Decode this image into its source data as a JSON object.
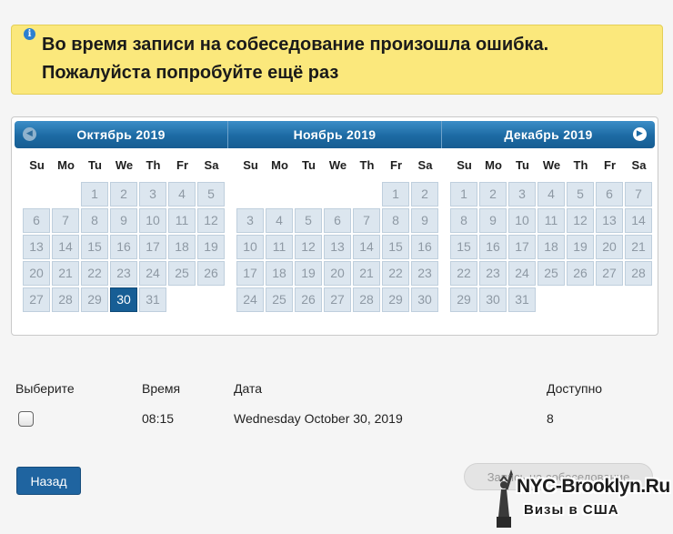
{
  "alert": {
    "icon": "info-icon",
    "line1": "Во время записи на собеседование произошла ошибка.",
    "line2": "Пожалуйста попробуйте ещё раз"
  },
  "calendar": {
    "weekdays": [
      "Su",
      "Mo",
      "Tu",
      "We",
      "Th",
      "Fr",
      "Sa"
    ],
    "prev_icon": "chevron-left-icon",
    "next_icon": "chevron-right-icon",
    "selected_date": "30",
    "months": [
      {
        "title": "Октябрь 2019",
        "cells": [
          "",
          "",
          "1",
          "2",
          "3",
          "4",
          "5",
          "6",
          "7",
          "8",
          "9",
          "10",
          "11",
          "12",
          "13",
          "14",
          "15",
          "16",
          "17",
          "18",
          "19",
          "20",
          "21",
          "22",
          "23",
          "24",
          "25",
          "26",
          "27",
          "28",
          "29",
          "30",
          "31"
        ]
      },
      {
        "title": "Ноябрь 2019",
        "cells": [
          "",
          "",
          "",
          "",
          "",
          "1",
          "2",
          "3",
          "4",
          "5",
          "6",
          "7",
          "8",
          "9",
          "10",
          "11",
          "12",
          "13",
          "14",
          "15",
          "16",
          "17",
          "18",
          "19",
          "20",
          "21",
          "22",
          "23",
          "24",
          "25",
          "26",
          "27",
          "28",
          "29",
          "30"
        ]
      },
      {
        "title": "Декабрь 2019",
        "cells": [
          "1",
          "2",
          "3",
          "4",
          "5",
          "6",
          "7",
          "8",
          "9",
          "10",
          "11",
          "12",
          "13",
          "14",
          "15",
          "16",
          "17",
          "18",
          "19",
          "20",
          "21",
          "22",
          "23",
          "24",
          "25",
          "26",
          "27",
          "28",
          "29",
          "30",
          "31"
        ]
      }
    ]
  },
  "slots": {
    "headers": {
      "select": "Выберите",
      "time": "Время",
      "date": "Дата",
      "available": "Доступно"
    },
    "rows": [
      {
        "time": "08:15",
        "date": "Wednesday October 30, 2019",
        "available": "8"
      }
    ]
  },
  "buttons": {
    "back": "Назад",
    "book": "Запись на собеседование"
  },
  "watermark": {
    "brand": "NYC-Brooklyn.Ru",
    "sub": "Визы в США"
  }
}
